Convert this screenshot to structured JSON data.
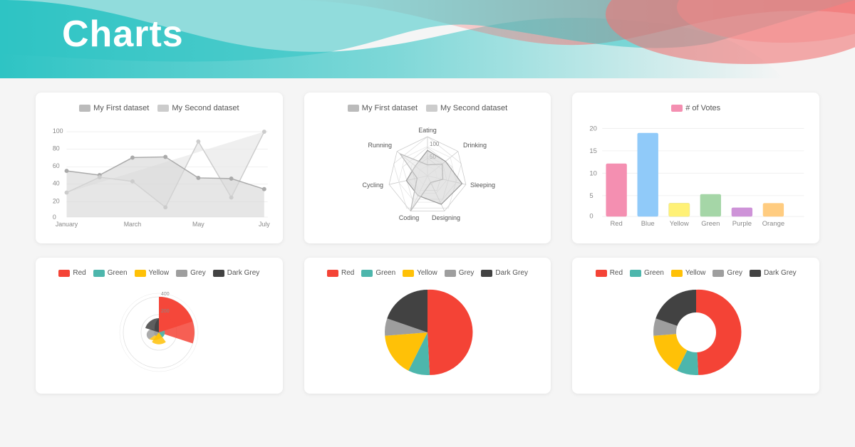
{
  "header": {
    "title": "Charts",
    "bg_color_left": "#2ec4c4",
    "bg_color_right": "#f07575"
  },
  "line_chart": {
    "datasets": [
      {
        "label": "My First dataset",
        "color": "#bbbbbb",
        "fill": "#e0e0e0"
      },
      {
        "label": "My Second dataset",
        "color": "#cccccc",
        "fill": "#f0f0f0"
      }
    ],
    "x_labels": [
      "January",
      "March",
      "May",
      "July"
    ],
    "y_labels": [
      "0",
      "20",
      "40",
      "60",
      "80",
      "100"
    ],
    "dataset1": [
      65,
      59,
      80,
      81,
      56,
      55,
      40
    ],
    "dataset2": [
      28,
      48,
      40,
      19,
      86,
      27,
      90
    ]
  },
  "radar_chart": {
    "datasets": [
      {
        "label": "My First dataset",
        "color": "#cccccc"
      },
      {
        "label": "My Second dataset",
        "color": "#aaaaaa"
      }
    ],
    "labels": [
      "Eating",
      "Drinking",
      "Sleeping",
      "Designing",
      "Coding",
      "Cycling",
      "Running"
    ],
    "scale_labels": [
      "50",
      "100"
    ]
  },
  "bar_chart": {
    "legend": [
      {
        "label": "# of Votes",
        "color": "#f48fb1"
      }
    ],
    "labels": [
      "Red",
      "Blue",
      "Yellow",
      "Green",
      "Purple",
      "Orange"
    ],
    "values": [
      12,
      19,
      3,
      5,
      2,
      3
    ],
    "colors": [
      "#f48fb1",
      "#90caf9",
      "#fff176",
      "#a5d6a7",
      "#ce93d8",
      "#ffcc80"
    ],
    "y_labels": [
      "0",
      "5",
      "10",
      "15",
      "20"
    ]
  },
  "pie_legends": {
    "items": [
      {
        "label": "Red",
        "color": "#f44336"
      },
      {
        "label": "Green",
        "color": "#4db6ac"
      },
      {
        "label": "Yellow",
        "color": "#ffc107"
      },
      {
        "label": "Grey",
        "color": "#9e9e9e"
      },
      {
        "label": "Dark Grey",
        "color": "#424242"
      }
    ]
  },
  "polar_chart": {
    "values": [
      300,
      50,
      100,
      40,
      120
    ],
    "colors": [
      "#f44336",
      "#4db6ac",
      "#ffc107",
      "#9e9e9e",
      "#424242"
    ],
    "scale_labels": [
      "200",
      "400"
    ]
  },
  "pie_chart": {
    "values": [
      300,
      50,
      100,
      40,
      120
    ],
    "colors": [
      "#f44336",
      "#4db6ac",
      "#ffc107",
      "#9e9e9e",
      "#424242"
    ]
  },
  "donut_chart": {
    "values": [
      300,
      50,
      100,
      40,
      120
    ],
    "colors": [
      "#f44336",
      "#4db6ac",
      "#ffc107",
      "#9e9e9e",
      "#424242"
    ]
  }
}
